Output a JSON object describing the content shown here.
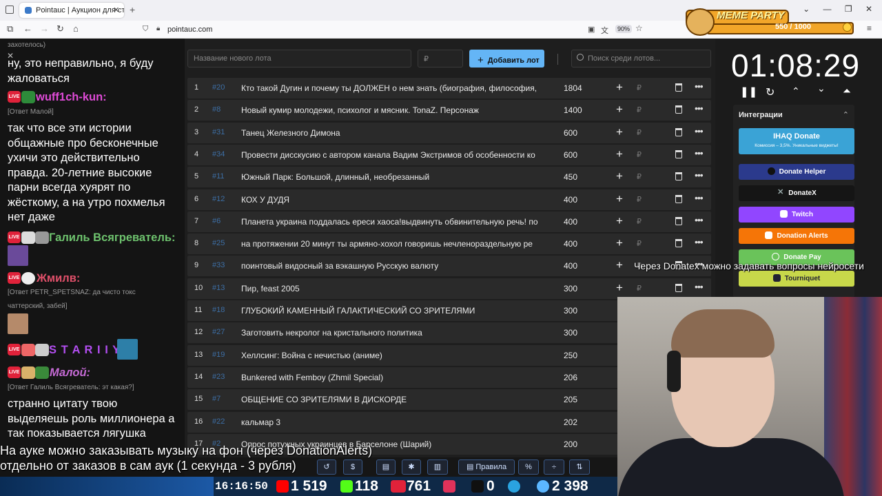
{
  "browser": {
    "tab_title": "Pointauc | Аукцион для стриме",
    "url": "pointauc.com",
    "zoom": "90%"
  },
  "meme_party": {
    "title": "MEME PARTY",
    "progress": "550 / 1000"
  },
  "chat": {
    "m0_tail": "захотелось)",
    "m0_text": "ну, это неправильно, я буду жаловаться",
    "u1": "wuff1ch-kun:",
    "u1_reply": "[Ответ Малой]",
    "u1_text": "так что все эти истории общажные про бесконечные ухичи это действительно правда. 20-летние высокие парни всегда хуярят по жёсткому, а на утро похмелья нет даже",
    "u2": "Галиль Всягреватель:",
    "u3": "Жмилв:",
    "u3_reply": "[Ответ PETR_SPETSNAZ: да чисто токс чаттерский, забей]",
    "u4": "S T A R I I Y:",
    "u5": "Малой:",
    "u5_reply": "[Ответ Галиль Всягреватель: эт какая?]",
    "u5_text": "странно цитату твою выделяешь роль миллионера а так показывается лягушка"
  },
  "lotbar": {
    "name_placeholder": "Название нового лота",
    "amount_placeholder": "₽",
    "add_label": "Добавить лот",
    "search_placeholder": "Поиск среди лотов..."
  },
  "lots": [
    {
      "n": "1",
      "id": "#20",
      "name": "Кто такой Дугин и почему ты ДОЛЖЕН о нем знать (биография, философия,",
      "amount": "1804"
    },
    {
      "n": "2",
      "id": "#8",
      "name": "Новый кумир молодежи, психолог и мясник. TonaZ. Персонаж",
      "amount": "1400"
    },
    {
      "n": "3",
      "id": "#31",
      "name": "Танец Железного Димона",
      "amount": "600"
    },
    {
      "n": "4",
      "id": "#34",
      "name": "Провести дисскусию с автором канала Вадим Экстримов об особенности ко",
      "amount": "600"
    },
    {
      "n": "5",
      "id": "#11",
      "name": "Южный Парк: Большой, длинный, необрезанный",
      "amount": "450"
    },
    {
      "n": "6",
      "id": "#12",
      "name": "КОХ У ДУДЯ",
      "amount": "400"
    },
    {
      "n": "7",
      "id": "#6",
      "name": "Планета украина поддалась ереси хаоса!выдвинуть обвинительную речь! по",
      "amount": "400"
    },
    {
      "n": "8",
      "id": "#25",
      "name": "на протяжении 20 минут ты армяно-хохол говоришь нечленораздельную ре",
      "amount": "400"
    },
    {
      "n": "9",
      "id": "#33",
      "name": "поинтовый видосный за вэкашную Русскую валюту",
      "amount": "400"
    },
    {
      "n": "10",
      "id": "#13",
      "name": "Пир, feast 2005",
      "amount": "300"
    },
    {
      "n": "11",
      "id": "#18",
      "name": "ГЛУБОКИЙ КАМЕННЫЙ ГАЛАКТИЧЕСКИЙ СО ЗРИТЕЛЯМИ",
      "amount": "300"
    },
    {
      "n": "12",
      "id": "#27",
      "name": "Заготовить некролог на кристального политика",
      "amount": "300"
    },
    {
      "n": "13",
      "id": "#19",
      "name": "Хеллсинг: Война с нечистью (аниме)",
      "amount": "250"
    },
    {
      "n": "14",
      "id": "#23",
      "name": "Bunkered with Femboy (Zhmil Special)",
      "amount": "206"
    },
    {
      "n": "15",
      "id": "#7",
      "name": "ОБЩЕНИЕ СО ЗРИТЕЛЯМИ В ДИСКОРДЕ",
      "amount": "205"
    },
    {
      "n": "16",
      "id": "#22",
      "name": "кальмар 3",
      "amount": "202"
    },
    {
      "n": "17",
      "id": "#2",
      "name": "Опрос потужных украинцев в Барселоне (Шарий)",
      "amount": "200"
    }
  ],
  "timer": {
    "value": "01:08:29"
  },
  "integrations": {
    "title": "Интеграции",
    "ihaq_title": "IHAQ Donate",
    "ihaq_sub": "Комиссия – 3,5%. Уникальные виджеты!",
    "items": [
      "Donate Helper",
      "DonateX",
      "Twitch",
      "Donation Alerts",
      "Donate Pay",
      "Tourniquet"
    ]
  },
  "overlay": {
    "right_text": "Через Donatex можно задавать вопросы нейросети",
    "left_line1": "На ауке можно заказывать музыку на фон (через DonationAlerts)",
    "left_line2": "отдельно от заказов в сам аук (1 секунда - 3 рубля)"
  },
  "toolbar": {
    "rules_label": "Правила",
    "percent_label": "%"
  },
  "status": {
    "clock": "16:16:50",
    "youtube": "1 519",
    "kick": "118",
    "vk": "761",
    "rutube": "0",
    "viewers": "2 398"
  },
  "colors": {
    "ihaq": "#3aa3d6",
    "donate_helper": "#2b3a8c",
    "donatex": "#151515",
    "twitch": "#9146ff",
    "donation_alerts": "#f57507",
    "donate_pay": "#6ac35a",
    "tourniquet": "#c8d84a",
    "add_button": "#64b5f6"
  }
}
